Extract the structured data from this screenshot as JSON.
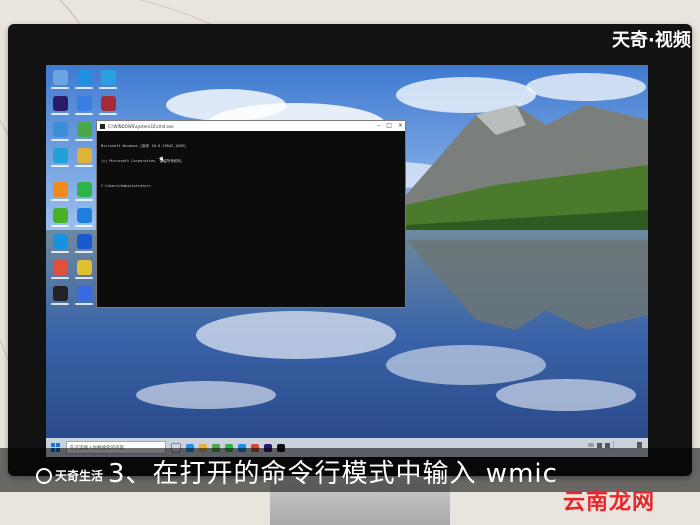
{
  "watermark_top": "天奇·视频",
  "watermark_bottom": "云南龙网",
  "brand": "天奇生活",
  "caption": "3、在打开的命令行模式中输入 wmic",
  "cmd": {
    "title": "C:\\WINDOWS\\system32\\cmd.exe",
    "lines": [
      "Microsoft Windows [版本 10.0.19042.1083]",
      "(c) Microsoft Corporation. 保留所有权利。",
      "",
      "C:\\Users\\Administrator>"
    ]
  },
  "taskbar": {
    "search_placeholder": "在这里输入你要搜索的内容"
  },
  "colors": {
    "sky": "#5a8fd6",
    "mountain": "#7a7f7c",
    "forest": "#2f5a22",
    "water": "#3a63a8",
    "cmd_bg": "#0c0c0c",
    "taskbar": "#d7e1ec",
    "watermark_red": "#e8262c"
  },
  "desktop_icons": [
    {
      "name": "recycle-bin-icon",
      "color": "#6aa5e0"
    },
    {
      "name": "edge-icon",
      "color": "#1f8fe0"
    },
    {
      "name": "app-blue-icon",
      "color": "#29a0e0"
    },
    {
      "name": "premiere-icon",
      "color": "#2a1a6a"
    },
    {
      "name": "app-square-icon",
      "color": "#3b7de0"
    },
    {
      "name": "app-red-icon",
      "color": "#a52a3a"
    },
    {
      "name": "network-icon",
      "color": "#3b8ed8"
    },
    {
      "name": "chrome-icon",
      "color": "#4aa84a"
    },
    {
      "name": "qq-icon",
      "color": "#1c8de0"
    },
    {
      "name": "media-player-icon",
      "color": "#22a0d8"
    },
    {
      "name": "folder-icon",
      "color": "#e0b23a"
    },
    {
      "name": "app-orange-icon",
      "color": "#f08a1a"
    },
    {
      "name": "wechat-icon",
      "color": "#2fb24a"
    },
    {
      "name": "app-green-icon",
      "color": "#49b028"
    },
    {
      "name": "security-icon",
      "color": "#1f7fe0"
    },
    {
      "name": "app-k-icon",
      "color": "#1a90e0"
    },
    {
      "name": "app-k2-icon",
      "color": "#1a5ad0"
    },
    {
      "name": "photos-icon",
      "color": "#e0503a"
    },
    {
      "name": "app-yellow-icon",
      "color": "#e0c030"
    },
    {
      "name": "app-multi-icon",
      "color": "#d04a30"
    },
    {
      "name": "app-x-icon",
      "color": "#222222"
    },
    {
      "name": "app-doc-icon",
      "color": "#3a6ae0"
    },
    {
      "name": "app-white-icon",
      "color": "#f0f0f0"
    }
  ]
}
